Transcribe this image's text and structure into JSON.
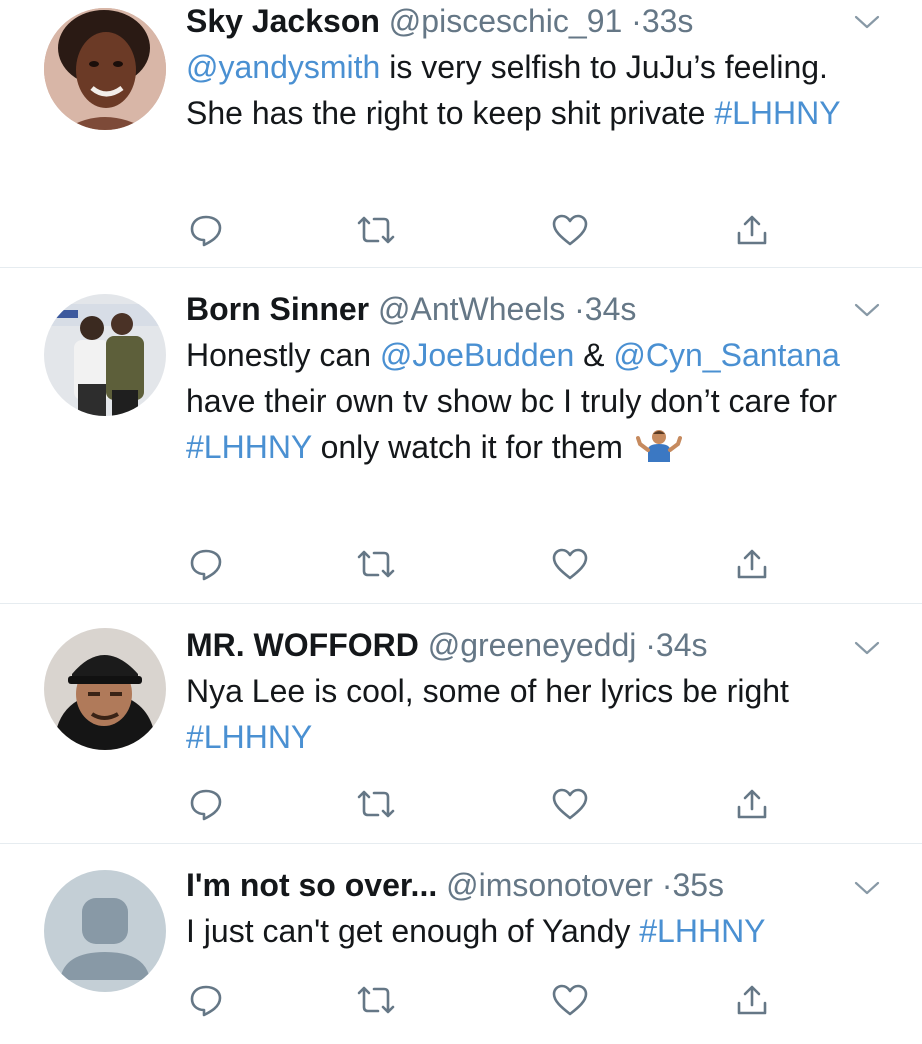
{
  "tweets": [
    {
      "name": "Sky Jackson",
      "handle": "@pisceschic_91",
      "separator": "·",
      "time": "33s",
      "body": [
        {
          "text": "@yandysmith",
          "link": true
        },
        {
          "text": " is very selfish to JuJu’s feeling. She has the right to keep shit private ",
          "link": false
        },
        {
          "text": "#LHHNY",
          "link": true
        }
      ],
      "avatar_icon": "profile-photo-woman"
    },
    {
      "name": "Born Sinner",
      "handle": "@AntWheels",
      "separator": "·",
      "time": "34s",
      "body": [
        {
          "text": "Honestly can ",
          "link": false
        },
        {
          "text": "@JoeBudden",
          "link": true
        },
        {
          "text": " & ",
          "link": false
        },
        {
          "text": "@Cyn_Santana",
          "link": true
        },
        {
          "text": " have their own tv show bc I truly don’t care for ",
          "link": false
        },
        {
          "text": "#LHHNY",
          "link": true
        },
        {
          "text": " only watch it for them ",
          "link": false
        }
      ],
      "emoji_icon": "person-shrugging-emoji",
      "avatar_icon": "profile-photo-two-men"
    },
    {
      "name": "MR. WOFFORD",
      "handle": "@greeneyeddj",
      "separator": "·",
      "time": "34s",
      "body": [
        {
          "text": "Nya Lee is cool, some of her lyrics be right ",
          "link": false
        },
        {
          "text": "#LHHNY",
          "link": true
        }
      ],
      "avatar_icon": "profile-photo-man-cap"
    },
    {
      "name": "I'm not so over...",
      "handle": "@imsonotover",
      "separator": "·",
      "time": "35s",
      "body": [
        {
          "text": "I just can't get enough of Yandy ",
          "link": false
        },
        {
          "text": "#LHHNY",
          "link": true
        }
      ],
      "avatar_icon": "default-avatar-icon"
    }
  ],
  "colors": {
    "link": "#4a90d2",
    "secondary_text": "#657786",
    "icon": "#657786",
    "divider": "#e6ecf0",
    "default_avatar_bg": "#c4cfd6",
    "default_avatar_fg": "#8899a6"
  },
  "action_icons": [
    "reply-icon",
    "retweet-icon",
    "like-icon",
    "share-icon"
  ]
}
